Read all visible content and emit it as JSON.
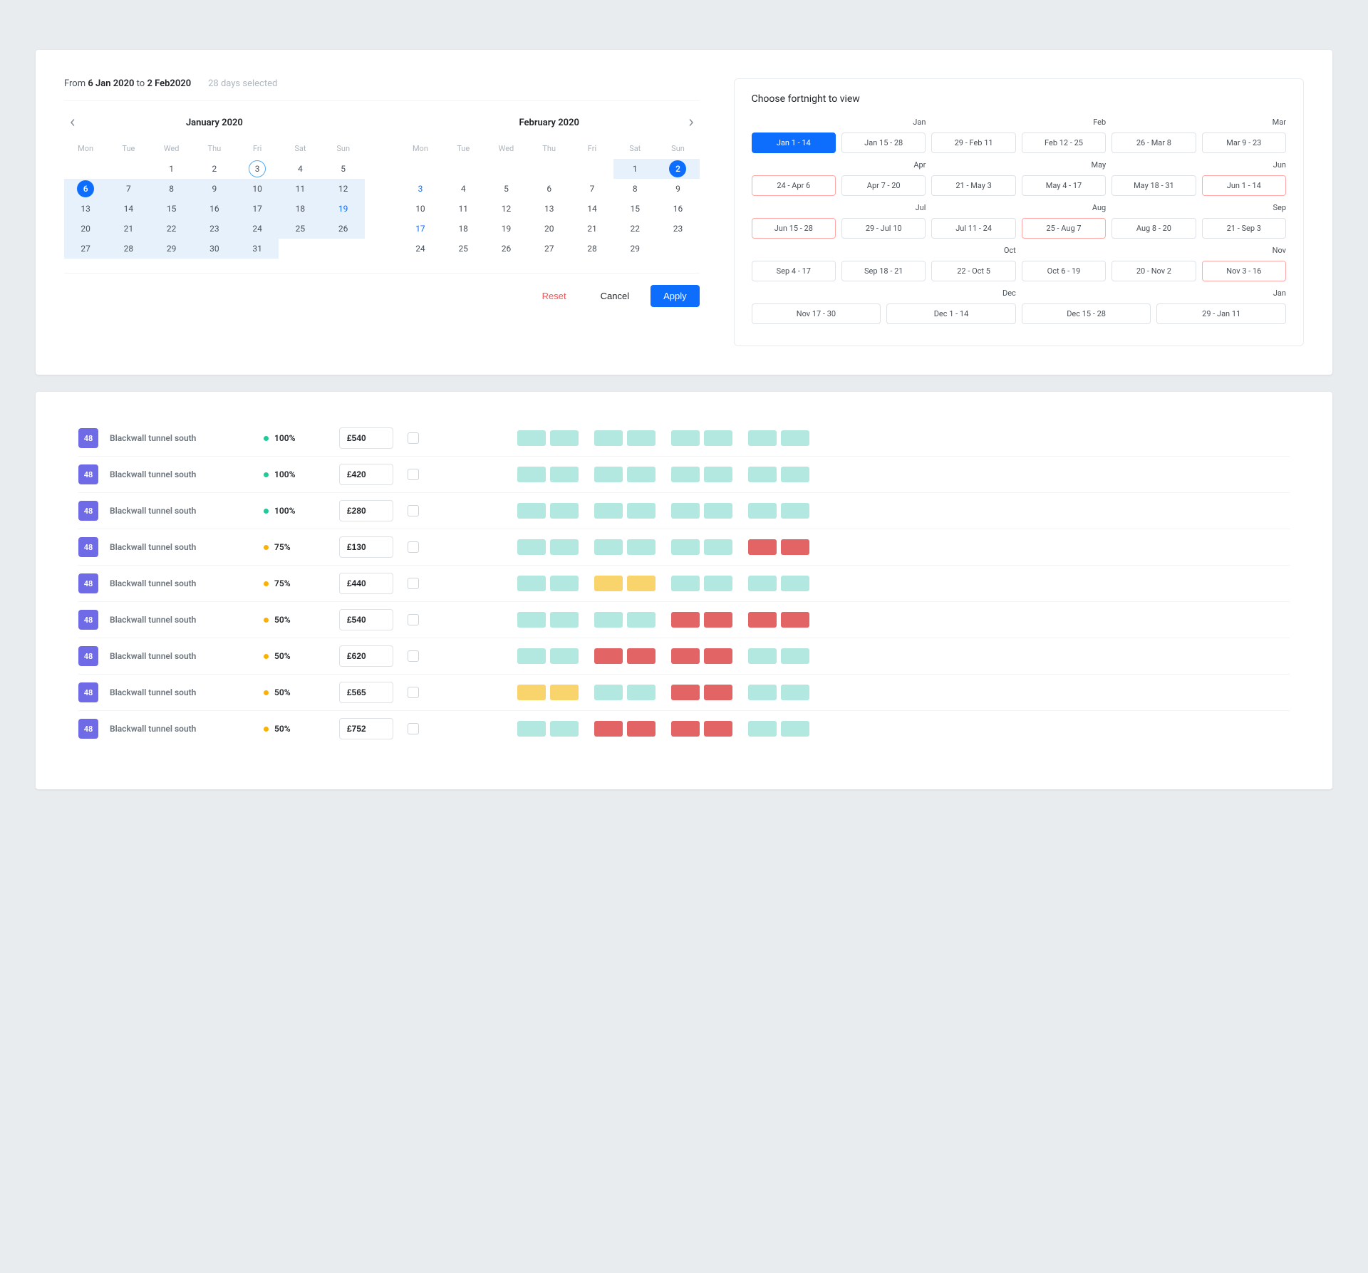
{
  "dateRange": {
    "prefix": "From ",
    "from": "6 Jan 2020",
    "mid": " to ",
    "to": "2 Feb2020",
    "daysSelected": "28 days selected"
  },
  "actions": {
    "reset": "Reset",
    "cancel": "Cancel",
    "apply": "Apply"
  },
  "dow": [
    "Mon",
    "Tue",
    "Wed",
    "Thu",
    "Fri",
    "Sat",
    "Sun"
  ],
  "months": [
    {
      "title": "January 2020",
      "leadingBlanks": 2,
      "days": [
        {
          "n": 1
        },
        {
          "n": 2
        },
        {
          "n": 3,
          "ring": true
        },
        {
          "n": 4
        },
        {
          "n": 5
        },
        {
          "n": 6,
          "circle": true,
          "range": true
        },
        {
          "n": 7,
          "range": true
        },
        {
          "n": 8,
          "range": true
        },
        {
          "n": 9,
          "range": true
        },
        {
          "n": 10,
          "range": true
        },
        {
          "n": 11,
          "range": true
        },
        {
          "n": 12,
          "range": true
        },
        {
          "n": 13,
          "range": true
        },
        {
          "n": 14,
          "range": true
        },
        {
          "n": 15,
          "range": true
        },
        {
          "n": 16,
          "range": true
        },
        {
          "n": 17,
          "range": true
        },
        {
          "n": 18,
          "range": true
        },
        {
          "n": 19,
          "range": true
        },
        {
          "n": 19,
          "range": true,
          "linked": true,
          "skip": true
        },
        {
          "n": 20,
          "range": true
        },
        {
          "n": 21,
          "range": true
        },
        {
          "n": 22,
          "range": true
        },
        {
          "n": 23,
          "range": true
        },
        {
          "n": 24,
          "range": true
        },
        {
          "n": 25,
          "range": true
        },
        {
          "n": 26,
          "range": true
        },
        {
          "n": 27,
          "range": true
        },
        {
          "n": 28,
          "range": true
        },
        {
          "n": 29,
          "range": true
        },
        {
          "n": 30,
          "range": true
        },
        {
          "n": 31,
          "range": true
        }
      ]
    },
    {
      "title": "February 2020",
      "leadingBlanks": 5,
      "days": [
        {
          "n": 1,
          "range": true
        },
        {
          "n": 2,
          "circle": true,
          "range": true
        },
        {
          "n": 3,
          "linked": true
        },
        {
          "n": 4
        },
        {
          "n": 5
        },
        {
          "n": 6
        },
        {
          "n": 7
        },
        {
          "n": 8
        },
        {
          "n": 9
        },
        {
          "n": 10
        },
        {
          "n": 11
        },
        {
          "n": 12
        },
        {
          "n": 13
        },
        {
          "n": 14
        },
        {
          "n": 15
        },
        {
          "n": 16
        },
        {
          "n": 17,
          "linked": true
        },
        {
          "n": 18
        },
        {
          "n": 19
        },
        {
          "n": 20
        },
        {
          "n": 21
        },
        {
          "n": 22
        },
        {
          "n": 23
        },
        {
          "n": 24
        },
        {
          "n": 25
        },
        {
          "n": 26
        },
        {
          "n": 27
        },
        {
          "n": 28
        },
        {
          "n": 29
        }
      ]
    }
  ],
  "fortnight": {
    "title": "Choose fortnight to view",
    "rows": [
      {
        "labels": [
          "Jan",
          "Feb",
          "Mar"
        ],
        "chips": [
          {
            "t": "Jan 1 - 14",
            "active": true
          },
          {
            "t": "Jan 15 - 28"
          },
          {
            "t": "29 - Feb 11"
          },
          {
            "t": "Feb 12 - 25"
          },
          {
            "t": "26 - Mar 8"
          },
          {
            "t": "Mar 9 - 23"
          }
        ]
      },
      {
        "labels": [
          "Apr",
          "May",
          "Jun"
        ],
        "chips": [
          {
            "t": "24 - Apr 6",
            "hl": true
          },
          {
            "t": "Apr 7 - 20"
          },
          {
            "t": "21 -  May 3"
          },
          {
            "t": "May 4 - 17"
          },
          {
            "t": "May 18  - 31"
          },
          {
            "t": "Jun 1 - 14",
            "hl": true
          }
        ]
      },
      {
        "labels": [
          "Jul",
          "Aug",
          "Sep"
        ],
        "chips": [
          {
            "t": "Jun 15 - 28",
            "hl": true
          },
          {
            "t": "29 - Jul 10"
          },
          {
            "t": "Jul 11 - 24"
          },
          {
            "t": "25 - Aug 7",
            "hl": true
          },
          {
            "t": "Aug 8 - 20"
          },
          {
            "t": "21 - Sep 3"
          }
        ]
      },
      {
        "labels": [
          "Oct",
          "Nov"
        ],
        "chips": [
          {
            "t": "Sep 4 - 17"
          },
          {
            "t": "Sep 18 - 21"
          },
          {
            "t": "22 - Oct 5"
          },
          {
            "t": "Oct 6 - 19"
          },
          {
            "t": "20 - Nov 2"
          },
          {
            "t": "Nov 3 - 16",
            "hl": true
          }
        ]
      },
      {
        "labels": [
          "Dec",
          "Jan"
        ],
        "chips": [
          {
            "t": "Nov 17 - 30"
          },
          {
            "t": "Dec 1 - 14"
          },
          {
            "t": "Dec 15  - 28"
          },
          {
            "t": "29 - Jan 11"
          }
        ]
      }
    ]
  },
  "rows": [
    {
      "num": "48",
      "name": "Blackwall tunnel south",
      "pct": "100%",
      "dot": "teal",
      "price": "£540",
      "slots": [
        "g",
        "g",
        "g",
        "g",
        "g",
        "g",
        "g",
        "g"
      ]
    },
    {
      "num": "48",
      "name": "Blackwall tunnel south",
      "pct": "100%",
      "dot": "teal",
      "price": "£420",
      "slots": [
        "g",
        "g",
        "g",
        "g",
        "g",
        "g",
        "g",
        "g"
      ]
    },
    {
      "num": "48",
      "name": "Blackwall tunnel south",
      "pct": "100%",
      "dot": "teal",
      "price": "£280",
      "slots": [
        "g",
        "g",
        "g",
        "g",
        "g",
        "g",
        "g",
        "g"
      ]
    },
    {
      "num": "48",
      "name": "Blackwall tunnel south",
      "pct": "75%",
      "dot": "yellow",
      "price": "£130",
      "slots": [
        "g",
        "g",
        "g",
        "g",
        "g",
        "g",
        "r",
        "r"
      ]
    },
    {
      "num": "48",
      "name": "Blackwall tunnel south",
      "pct": "75%",
      "dot": "yellow",
      "price": "£440",
      "slots": [
        "g",
        "g",
        "y",
        "y",
        "g",
        "g",
        "g",
        "g"
      ]
    },
    {
      "num": "48",
      "name": "Blackwall tunnel south",
      "pct": "50%",
      "dot": "yellow",
      "price": "£540",
      "slots": [
        "g",
        "g",
        "g",
        "g",
        "r",
        "r",
        "r",
        "r"
      ]
    },
    {
      "num": "48",
      "name": "Blackwall tunnel south",
      "pct": "50%",
      "dot": "yellow",
      "price": "£620",
      "slots": [
        "g",
        "g",
        "r",
        "r",
        "r",
        "r",
        "g",
        "g"
      ]
    },
    {
      "num": "48",
      "name": "Blackwall tunnel south",
      "pct": "50%",
      "dot": "yellow",
      "price": "£565",
      "slots": [
        "y",
        "y",
        "g",
        "g",
        "r",
        "r",
        "g",
        "g"
      ]
    },
    {
      "num": "48",
      "name": "Blackwall tunnel south",
      "pct": "50%",
      "dot": "yellow",
      "price": "£752",
      "slots": [
        "g",
        "g",
        "r",
        "r",
        "r",
        "r",
        "g",
        "g"
      ]
    }
  ]
}
